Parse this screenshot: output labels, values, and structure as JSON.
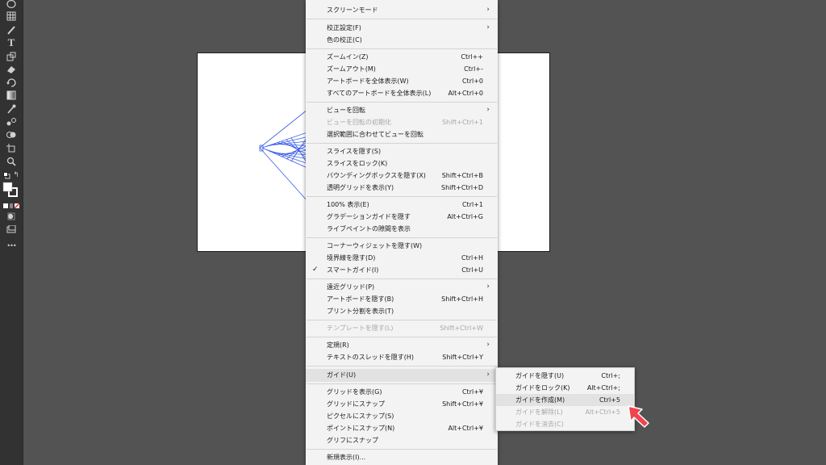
{
  "toolbar": {
    "tools": [
      "ellipse-icon",
      "grid-icon",
      "paintbrush-icon",
      "type-icon",
      "transform-icon",
      "eraser-icon",
      "rotate-icon",
      "gradient-icon",
      "eyedropper-icon",
      "blend-icon",
      "shape-builder-icon",
      "artboard-icon",
      "zoom-icon",
      "default-colors-icon",
      "swap-colors-icon",
      "fill-stroke-swatch",
      "color-mode-icons",
      "draw-mode-icon",
      "screen-mode-icon",
      "more-tools-icon"
    ],
    "more_label": "•••"
  },
  "view_menu": {
    "items": [
      {
        "label": "スクリーンモード",
        "shortcut": "",
        "submenu": true
      },
      {
        "label": "校正設定(F)",
        "shortcut": "",
        "submenu": true
      },
      {
        "label": "色の校正(C)",
        "shortcut": ""
      },
      {
        "label": "ズームイン(Z)",
        "shortcut": "Ctrl++"
      },
      {
        "label": "ズームアウト(M)",
        "shortcut": "Ctrl+-"
      },
      {
        "label": "アートボードを全体表示(W)",
        "shortcut": "Ctrl+0"
      },
      {
        "label": "すべてのアートボードを全体表示(L)",
        "shortcut": "Alt+Ctrl+0"
      },
      {
        "label": "ビューを回転",
        "shortcut": "",
        "submenu": true
      },
      {
        "label": "ビューを回転の初期化",
        "shortcut": "Shift+Ctrl+1",
        "disabled": true
      },
      {
        "label": "選択範囲に合わせてビューを回転",
        "shortcut": ""
      },
      {
        "label": "スライスを隠す(S)",
        "shortcut": ""
      },
      {
        "label": "スライスをロック(K)",
        "shortcut": ""
      },
      {
        "label": "バウンディングボックスを隠す(X)",
        "shortcut": "Shift+Ctrl+B"
      },
      {
        "label": "透明グリッドを表示(Y)",
        "shortcut": "Shift+Ctrl+D"
      },
      {
        "label": "100% 表示(E)",
        "shortcut": "Ctrl+1"
      },
      {
        "label": "グラデーションガイドを隠す",
        "shortcut": "Alt+Ctrl+G"
      },
      {
        "label": "ライブペイントの隙間を表示",
        "shortcut": ""
      },
      {
        "label": "コーナーウィジェットを隠す(W)",
        "shortcut": ""
      },
      {
        "label": "境界線を隠す(D)",
        "shortcut": "Ctrl+H"
      },
      {
        "label": "スマートガイド(I)",
        "shortcut": "Ctrl+U",
        "checked": true
      },
      {
        "label": "遠近グリッド(P)",
        "shortcut": "",
        "submenu": true
      },
      {
        "label": "アートボードを隠す(B)",
        "shortcut": "Shift+Ctrl+H"
      },
      {
        "label": "プリント分割を表示(T)",
        "shortcut": ""
      },
      {
        "label": "テンプレートを隠す(L)",
        "shortcut": "Shift+Ctrl+W",
        "disabled": true
      },
      {
        "label": "定規(R)",
        "shortcut": "",
        "submenu": true
      },
      {
        "label": "テキストのスレッドを隠す(H)",
        "shortcut": "Shift+Ctrl+Y"
      },
      {
        "label": "ガイド(U)",
        "shortcut": "",
        "submenu": true,
        "highlighted": true
      },
      {
        "label": "グリッドを表示(G)",
        "shortcut": "Ctrl+¥"
      },
      {
        "label": "グリッドにスナップ",
        "shortcut": "Shift+Ctrl+¥"
      },
      {
        "label": "ピクセルにスナップ(S)",
        "shortcut": ""
      },
      {
        "label": "ポイントにスナップ(N)",
        "shortcut": "Alt+Ctrl+¥"
      },
      {
        "label": "グリフにスナップ",
        "shortcut": ""
      },
      {
        "label": "新規表示(I)...",
        "shortcut": ""
      }
    ]
  },
  "guide_submenu": {
    "items": [
      {
        "label": "ガイドを隠す(U)",
        "shortcut": "Ctrl+;"
      },
      {
        "label": "ガイドをロック(K)",
        "shortcut": "Alt+Ctrl+;"
      },
      {
        "label": "ガイドを作成(M)",
        "shortcut": "Ctrl+5",
        "highlighted": true
      },
      {
        "label": "ガイドを解除(L)",
        "shortcut": "Alt+Ctrl+5",
        "disabled": true
      },
      {
        "label": "ガイドを消去(C)",
        "shortcut": "",
        "disabled": true
      }
    ]
  },
  "colors": {
    "app_bg": "#535353",
    "toolbar_bg": "#323232",
    "menu_bg": "#f3f3f3",
    "highlight": "#e2e2e2",
    "artwork_stroke": "#3a5ee8",
    "pointer": "#f0444e"
  }
}
